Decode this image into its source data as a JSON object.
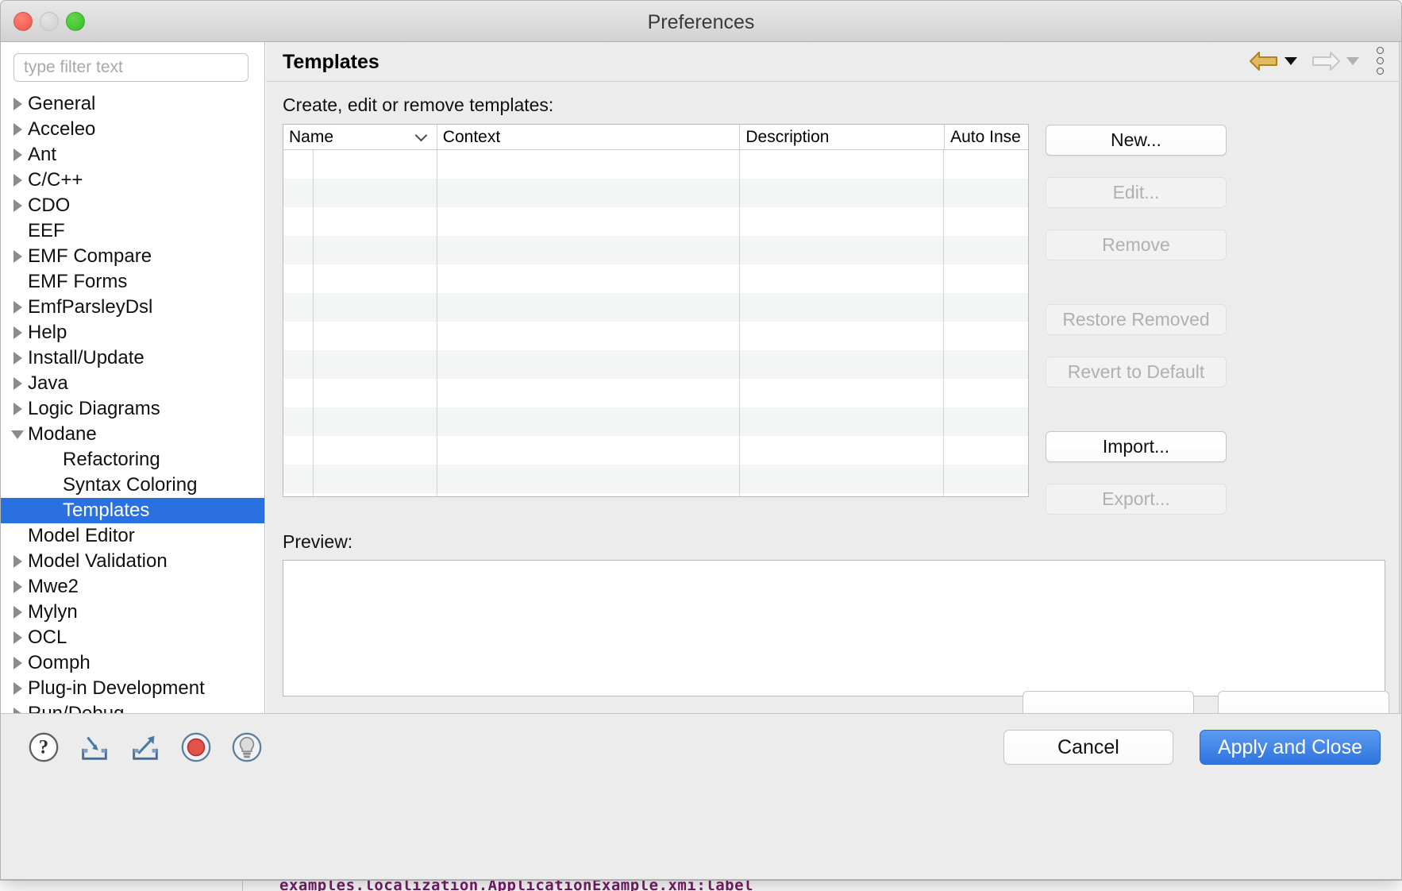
{
  "window": {
    "title": "Preferences",
    "traffic_lights": [
      "close",
      "minimize",
      "zoom"
    ]
  },
  "sidebar": {
    "filter": {
      "value": "",
      "placeholder": "type filter text"
    },
    "items": [
      {
        "label": "General",
        "depth": 0,
        "expandable": true,
        "expanded": false,
        "selected": false
      },
      {
        "label": "Acceleo",
        "depth": 0,
        "expandable": true,
        "expanded": false,
        "selected": false
      },
      {
        "label": "Ant",
        "depth": 0,
        "expandable": true,
        "expanded": false,
        "selected": false
      },
      {
        "label": "C/C++",
        "depth": 0,
        "expandable": true,
        "expanded": false,
        "selected": false
      },
      {
        "label": "CDO",
        "depth": 0,
        "expandable": true,
        "expanded": false,
        "selected": false
      },
      {
        "label": "EEF",
        "depth": 0,
        "expandable": false,
        "expanded": false,
        "selected": false
      },
      {
        "label": "EMF Compare",
        "depth": 0,
        "expandable": true,
        "expanded": false,
        "selected": false
      },
      {
        "label": "EMF Forms",
        "depth": 0,
        "expandable": false,
        "expanded": false,
        "selected": false
      },
      {
        "label": "EmfParsleyDsl",
        "depth": 0,
        "expandable": true,
        "expanded": false,
        "selected": false
      },
      {
        "label": "Help",
        "depth": 0,
        "expandable": true,
        "expanded": false,
        "selected": false
      },
      {
        "label": "Install/Update",
        "depth": 0,
        "expandable": true,
        "expanded": false,
        "selected": false
      },
      {
        "label": "Java",
        "depth": 0,
        "expandable": true,
        "expanded": false,
        "selected": false
      },
      {
        "label": "Logic Diagrams",
        "depth": 0,
        "expandable": true,
        "expanded": false,
        "selected": false
      },
      {
        "label": "Modane",
        "depth": 0,
        "expandable": true,
        "expanded": true,
        "selected": false
      },
      {
        "label": "Refactoring",
        "depth": 1,
        "expandable": false,
        "expanded": false,
        "selected": false
      },
      {
        "label": "Syntax Coloring",
        "depth": 1,
        "expandable": false,
        "expanded": false,
        "selected": false
      },
      {
        "label": "Templates",
        "depth": 1,
        "expandable": false,
        "expanded": false,
        "selected": true
      },
      {
        "label": "Model Editor",
        "depth": 0,
        "expandable": false,
        "expanded": false,
        "selected": false
      },
      {
        "label": "Model Validation",
        "depth": 0,
        "expandable": true,
        "expanded": false,
        "selected": false
      },
      {
        "label": "Mwe2",
        "depth": 0,
        "expandable": true,
        "expanded": false,
        "selected": false
      },
      {
        "label": "Mylyn",
        "depth": 0,
        "expandable": true,
        "expanded": false,
        "selected": false
      },
      {
        "label": "OCL",
        "depth": 0,
        "expandable": true,
        "expanded": false,
        "selected": false
      },
      {
        "label": "Oomph",
        "depth": 0,
        "expandable": true,
        "expanded": false,
        "selected": false
      },
      {
        "label": "Plug-in Development",
        "depth": 0,
        "expandable": true,
        "expanded": false,
        "selected": false
      },
      {
        "label": "Run/Debug",
        "depth": 0,
        "expandable": true,
        "expanded": false,
        "selected": false
      }
    ],
    "selected_accent": "#2a70e0"
  },
  "pane": {
    "title": "Templates",
    "nav": {
      "back_label": "Back",
      "back_enabled": true,
      "forward_label": "Forward",
      "forward_enabled": false,
      "menu_label": "View Menu",
      "back_color": "#c79a2e",
      "forward_color": "#c8c8c8"
    },
    "section_label": "Create, edit or remove templates:",
    "table": {
      "columns": [
        {
          "key": "name",
          "label": "Name",
          "sorted": true,
          "sort_dir": "down"
        },
        {
          "key": "context",
          "label": "Context",
          "sorted": false,
          "sort_dir": ""
        },
        {
          "key": "desc",
          "label": "Description",
          "sorted": false,
          "sort_dir": ""
        },
        {
          "key": "auto",
          "label": "Auto Inse",
          "sorted": false,
          "sort_dir": ""
        }
      ],
      "rows": [],
      "empty_row_count": 13
    },
    "buttons": [
      {
        "label": "New...",
        "enabled": true,
        "gap_after": "md"
      },
      {
        "label": "Edit...",
        "enabled": false,
        "gap_after": "md"
      },
      {
        "label": "Remove",
        "enabled": false,
        "gap_after": "lg"
      },
      {
        "label": "Restore Removed",
        "enabled": false,
        "gap_after": "md"
      },
      {
        "label": "Revert to Default",
        "enabled": false,
        "gap_after": "lg"
      },
      {
        "label": "Import...",
        "enabled": true,
        "gap_after": "md"
      },
      {
        "label": "Export...",
        "enabled": false,
        "gap_after": ""
      }
    ],
    "preview_label": "Preview:",
    "preview_content": ""
  },
  "footer": {
    "icons": [
      {
        "name": "help-icon",
        "title": "Help"
      },
      {
        "name": "import-icon",
        "title": "Import Preferences"
      },
      {
        "name": "export-icon",
        "title": "Export Preferences"
      },
      {
        "name": "record-icon",
        "title": "Record"
      },
      {
        "name": "tips-icon",
        "title": "Tips"
      }
    ],
    "cancel_label": "Cancel",
    "apply_label": "Apply and Close",
    "apply_accent": "#2f74e0"
  },
  "background": {
    "code_fragment": "examples.localization.ApplicationExample.xmi:label"
  }
}
